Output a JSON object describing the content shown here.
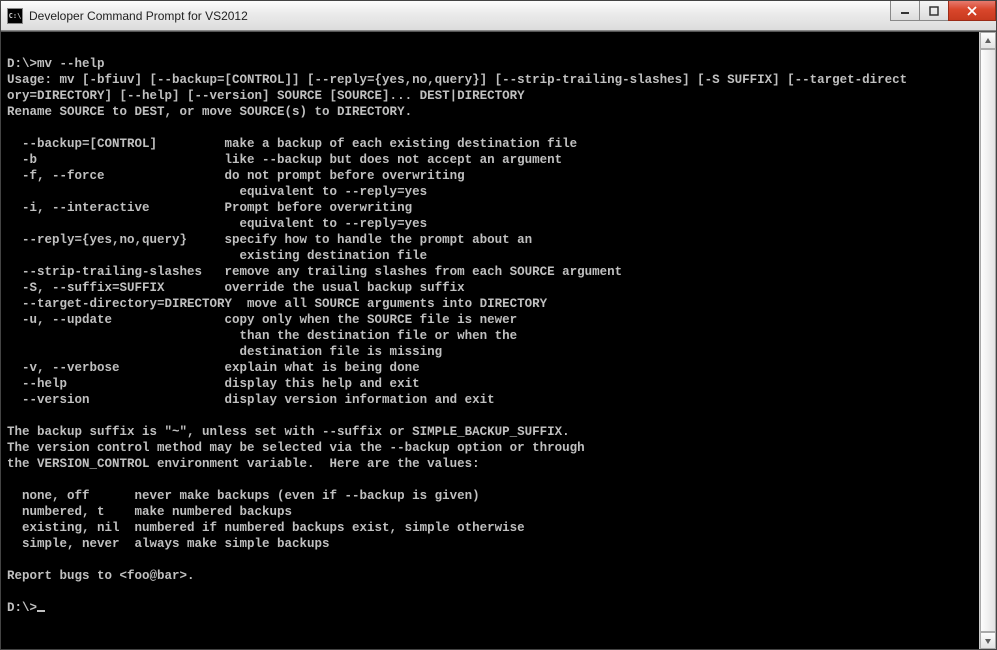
{
  "window": {
    "title": "Developer Command Prompt for VS2012",
    "app_icon_text": "C:\\"
  },
  "prompt": {
    "path": "D:\\>",
    "command": "mv --help"
  },
  "output": {
    "usage": "Usage: mv [-bfiuv] [--backup=[CONTROL]] [--reply={yes,no,query}] [--strip-trailing-slashes] [-S SUFFIX] [--target-direct\nory=DIRECTORY] [--help] [--version] SOURCE [SOURCE]... DEST|DIRECTORY",
    "summary": "Rename SOURCE to DEST, or move SOURCE(s) to DIRECTORY.",
    "options": [
      {
        "flag": "  --backup=[CONTROL]         ",
        "desc": "make a backup of each existing destination file"
      },
      {
        "flag": "  -b                         ",
        "desc": "like --backup but does not accept an argument"
      },
      {
        "flag": "  -f, --force                ",
        "desc": "do not prompt before overwriting"
      },
      {
        "flag": "                             ",
        "desc": "  equivalent to --reply=yes"
      },
      {
        "flag": "  -i, --interactive          ",
        "desc": "Prompt before overwriting"
      },
      {
        "flag": "                             ",
        "desc": "  equivalent to --reply=yes"
      },
      {
        "flag": "  --reply={yes,no,query}     ",
        "desc": "specify how to handle the prompt about an"
      },
      {
        "flag": "                             ",
        "desc": "  existing destination file"
      },
      {
        "flag": "  --strip-trailing-slashes   ",
        "desc": "remove any trailing slashes from each SOURCE argument"
      },
      {
        "flag": "  -S, --suffix=SUFFIX        ",
        "desc": "override the usual backup suffix"
      },
      {
        "flag": "  --target-directory=DIRECTORY  ",
        "desc": "move all SOURCE arguments into DIRECTORY"
      },
      {
        "flag": "  -u, --update               ",
        "desc": "copy only when the SOURCE file is newer"
      },
      {
        "flag": "                             ",
        "desc": "  than the destination file or when the"
      },
      {
        "flag": "                             ",
        "desc": "  destination file is missing"
      },
      {
        "flag": "  -v, --verbose              ",
        "desc": "explain what is being done"
      },
      {
        "flag": "  --help                     ",
        "desc": "display this help and exit"
      },
      {
        "flag": "  --version                  ",
        "desc": "display version information and exit"
      }
    ],
    "backup_note1": "The backup suffix is \"~\", unless set with --suffix or SIMPLE_BACKUP_SUFFIX.",
    "backup_note2": "The version control method may be selected via the --backup option or through",
    "backup_note3": "the VERSION_CONTROL environment variable.  Here are the values:",
    "vc_values": [
      {
        "k": "  none, off      ",
        "v": "never make backups (even if --backup is given)"
      },
      {
        "k": "  numbered, t    ",
        "v": "make numbered backups"
      },
      {
        "k": "  existing, nil  ",
        "v": "numbered if numbered backups exist, simple otherwise"
      },
      {
        "k": "  simple, never  ",
        "v": "always make simple backups"
      }
    ],
    "bugs": "Report bugs to <foo@bar>."
  },
  "prompt2": {
    "path": "D:\\>"
  }
}
